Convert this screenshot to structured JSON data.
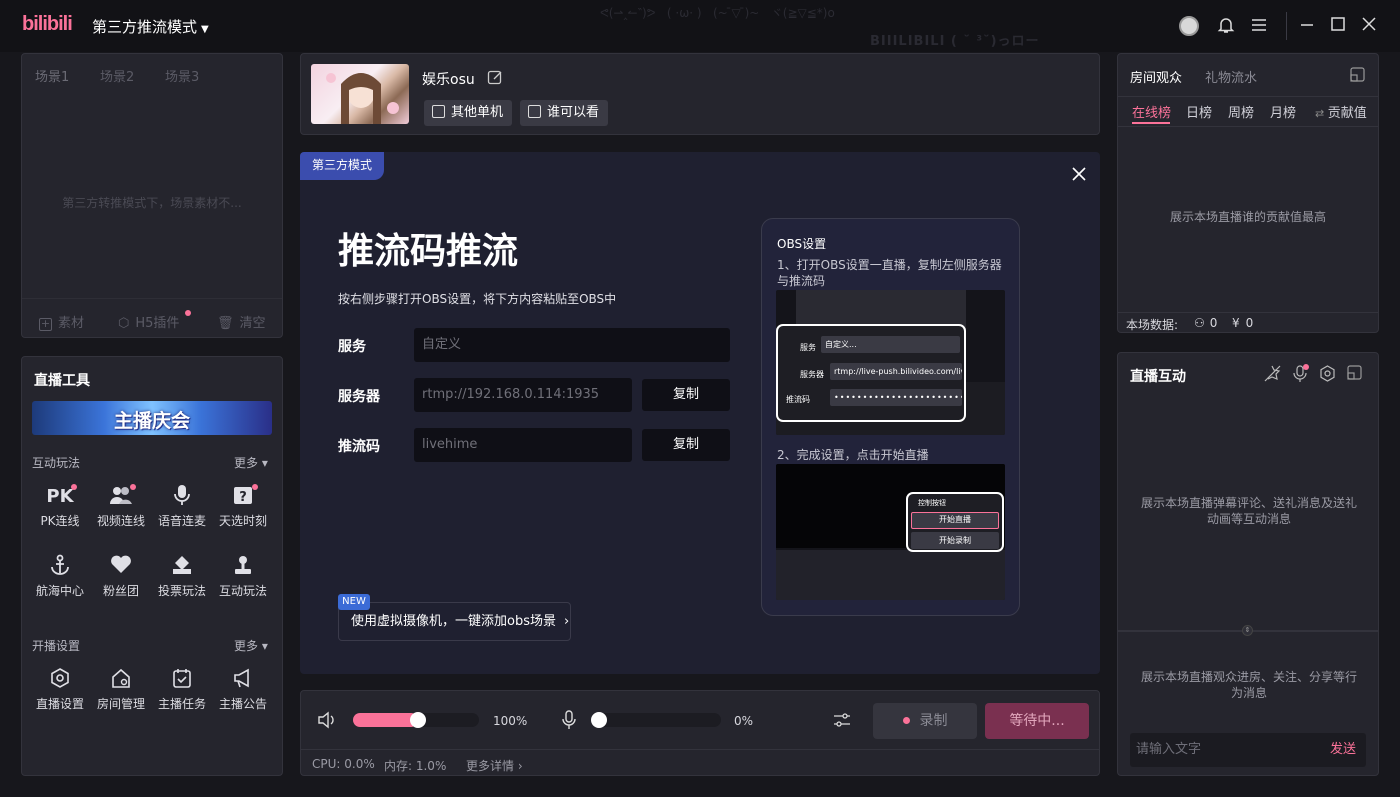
{
  "app": {
    "logo": "bilibili",
    "mode": "第三方推流模式"
  },
  "scenes": {
    "tabs": [
      "场景1",
      "场景2",
      "场景3"
    ],
    "empty_text": "第三方转推模式下，场景素材不...",
    "footer": {
      "material": "素材",
      "h5": "H5插件",
      "clear": "清空"
    }
  },
  "tools": {
    "title": "直播工具",
    "banner": "主播庆会",
    "interactive": {
      "title": "互动玩法",
      "more": "更多",
      "items": [
        {
          "label": "PK连线",
          "icon": "PK"
        },
        {
          "label": "视频连线",
          "icon": "users-icon"
        },
        {
          "label": "语音连麦",
          "icon": "mic-icon"
        },
        {
          "label": "天选时刻",
          "icon": "gift-question-icon"
        },
        {
          "label": "航海中心",
          "icon": "anchor-icon"
        },
        {
          "label": "粉丝团",
          "icon": "heart-icon"
        },
        {
          "label": "投票玩法",
          "icon": "vote-icon"
        },
        {
          "label": "互动玩法",
          "icon": "joystick-icon"
        }
      ]
    },
    "settings": {
      "title": "开播设置",
      "more": "更多",
      "items": [
        {
          "label": "直播设置",
          "icon": "settings-icon"
        },
        {
          "label": "房间管理",
          "icon": "home-icon"
        },
        {
          "label": "主播任务",
          "icon": "task-icon"
        },
        {
          "label": "主播公告",
          "icon": "megaphone-icon"
        }
      ]
    }
  },
  "room": {
    "title": "娱乐osu",
    "category": "其他单机",
    "visibility": "谁可以看"
  },
  "stream": {
    "badge": "第三方模式",
    "heading": "推流码推流",
    "description": "按右侧步骤打开OBS设置，将下方内容粘贴至OBS中",
    "fields": {
      "service": {
        "label": "服务",
        "value": "自定义"
      },
      "server": {
        "label": "服务器",
        "value": "rtmp://192.168.0.114:1935",
        "copy": "复制"
      },
      "key": {
        "label": "推流码",
        "value": "livehime",
        "copy": "复制"
      }
    },
    "new_tag": "NEW",
    "virtual_cam": "使用虚拟摄像机，一键添加obs场景",
    "obs": {
      "title": "OBS设置",
      "step1": "1、打开OBS设置一直播，复制左侧服务器与推流码",
      "step1_labels": {
        "service": "服务",
        "service_val": "自定义...",
        "server": "服务器",
        "server_val": "rtmp://live-push.bilivideo.com/live-",
        "key": "推流码"
      },
      "step2": "2、完成设置，点击开始直播",
      "step2_labels": {
        "controls": "控制按钮",
        "start_stream": "开始直播",
        "start_record": "开始录制"
      }
    }
  },
  "controls": {
    "volume": {
      "value": 1.0,
      "label": "100%"
    },
    "mic": {
      "value": 0.0,
      "label": "0%"
    },
    "record": "录制",
    "waiting": "等待中...",
    "status": {
      "cpu": "CPU: 0.0%",
      "mem": "内存: 1.0%",
      "details": "更多详情"
    }
  },
  "audience": {
    "tabs": [
      "房间观众",
      "礼物流水"
    ],
    "ranks": [
      "在线榜",
      "日榜",
      "周榜",
      "月榜",
      "贡献值"
    ],
    "empty": "展示本场直播谁的贡献值最高",
    "stats_label": "本场数据:",
    "viewers": "0",
    "coins": "0"
  },
  "interaction": {
    "title": "直播互动",
    "danmaku_hint": "展示本场直播弹幕评论、送礼消息及送礼动画等互动消息",
    "enter_hint": "展示本场直播观众进房、关注、分享等行为消息",
    "input_placeholder": "请输入文字",
    "send": "发送"
  },
  "colors": {
    "accent": "#fb7299",
    "badge": "#3b4dae",
    "bg": "#17171c",
    "panel": "#25252d"
  }
}
